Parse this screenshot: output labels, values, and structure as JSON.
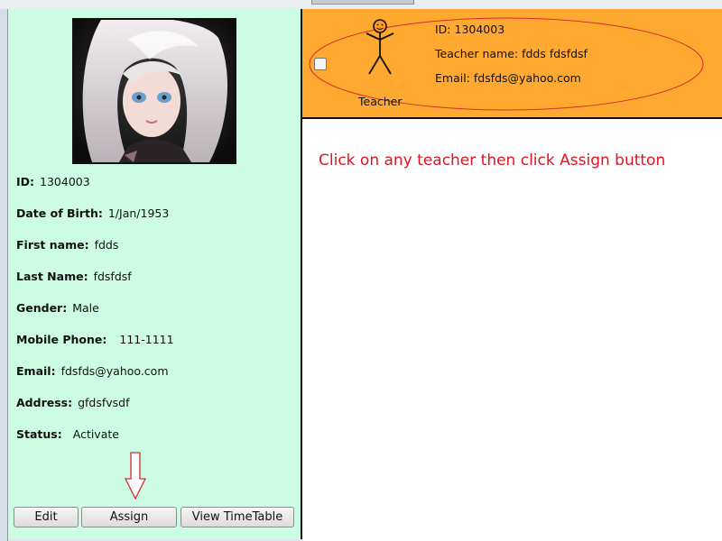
{
  "student": {
    "fields": [
      {
        "label": "ID:",
        "value": "1304003"
      },
      {
        "label": "Date of Birth:",
        "value": "1/Jan/1953"
      },
      {
        "label": "First name:",
        "value": "fdds"
      },
      {
        "label": "Last Name:",
        "value": "fdsfdsf"
      },
      {
        "label": "Gender:",
        "value": "Male"
      },
      {
        "label": "Mobile Phone:",
        "value": "111-1111"
      },
      {
        "label": "Email:",
        "value": "fdsfds@yahoo.com"
      },
      {
        "label": "Address:",
        "value": "gfdsfvsdf"
      },
      {
        "label": "Status:",
        "value": "Activate"
      }
    ]
  },
  "buttons": {
    "edit": "Edit",
    "assign": "Assign",
    "view_timetable": "View TimeTable"
  },
  "teacher_card": {
    "id_line": "ID: 1304003",
    "name_line": "Teacher name: fdds fdsfdsf",
    "email_line": "Email: fdsfds@yahoo.com",
    "figure_label": "Teacher",
    "selected": false
  },
  "instruction": "Click on any teacher then click Assign button",
  "colors": {
    "left_panel_bg": "#ccfde4",
    "card_bg": "#ffa930",
    "highlight": "#e0141e"
  }
}
